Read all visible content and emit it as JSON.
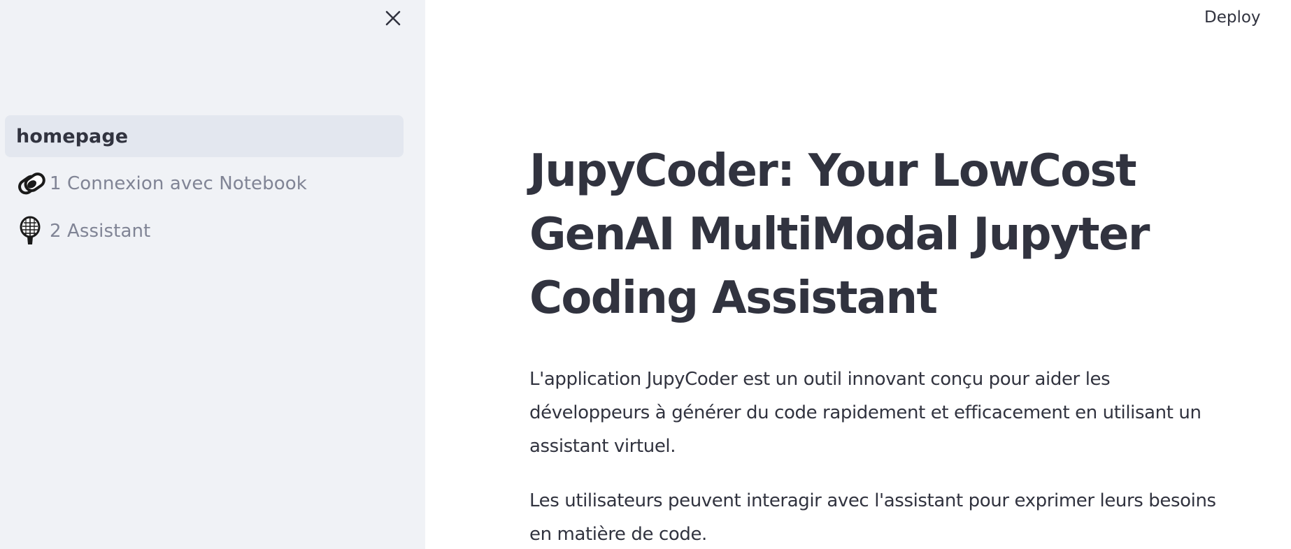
{
  "header": {
    "deploy_label": "Deploy"
  },
  "sidebar": {
    "close_icon": "close-icon",
    "items": [
      {
        "label": "homepage",
        "active": true,
        "icon": ""
      },
      {
        "label": "1 Connexion avec Notebook",
        "active": false,
        "icon": "link-icon"
      },
      {
        "label": "2 Assistant",
        "active": false,
        "icon": "microphone-icon"
      }
    ]
  },
  "main": {
    "title": "JupyCoder: Your LowCost GenAI MultiModal Jupyter Coding Assistant",
    "paragraphs": [
      "L'application JupyCoder est un outil innovant conçu pour aider les développeurs à générer du code rapidement et efficacement en utilisant un assistant virtuel.",
      "Les utilisateurs peuvent interagir avec l'assistant pour exprimer leurs besoins en matière de code."
    ]
  },
  "colors": {
    "sidebar_bg": "#f0f2f6",
    "active_item_bg": "#e3e7ef",
    "text_primary": "#31333f",
    "text_muted": "#808495"
  }
}
